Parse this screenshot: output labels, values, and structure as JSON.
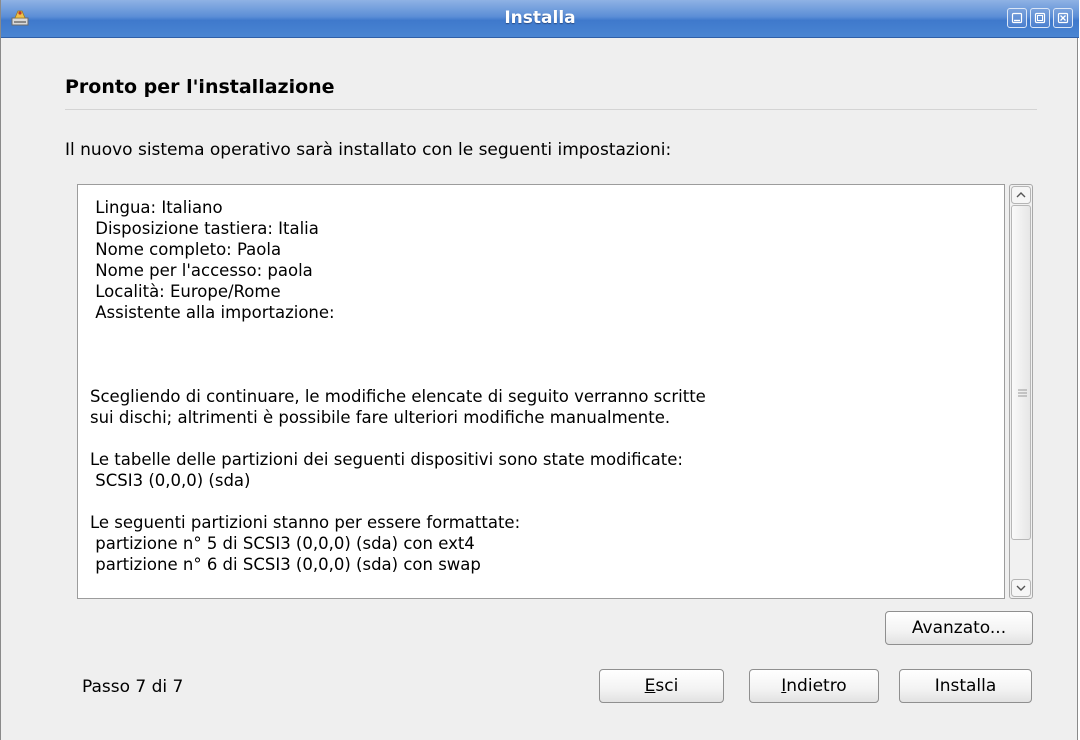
{
  "window": {
    "title": "Installa",
    "icon": "installer-icon",
    "controls": [
      "minimize-icon",
      "maximize-icon",
      "close-icon"
    ]
  },
  "page": {
    "heading": "Pronto per l'installazione",
    "intro": "Il nuovo sistema operativo sarà installato con le seguenti impostazioni:"
  },
  "summary": {
    "lines": [
      " Lingua: Italiano",
      " Disposizione tastiera: Italia",
      " Nome completo: Paola",
      " Nome per l'accesso: paola",
      " Località: Europe/Rome",
      " Assistente alla importazione:",
      "",
      "",
      "",
      "Scegliendo di continuare, le modifiche elencate di seguito verranno scritte",
      "sui dischi; altrimenti è possibile fare ulteriori modifiche manualmente.",
      "",
      "Le tabelle delle partizioni dei seguenti dispositivi sono state modificate:",
      " SCSI3 (0,0,0) (sda)",
      "",
      "Le seguenti partizioni stanno per essere formattate:",
      " partizione n° 5 di SCSI3 (0,0,0) (sda) con ext4",
      " partizione n° 6 di SCSI3 (0,0,0) (sda) con swap"
    ]
  },
  "buttons": {
    "advanced": "Avanzato...",
    "quit_mnemonic": "E",
    "quit_rest": "sci",
    "back_mnemonic": "I",
    "back_rest": "ndietro",
    "install": "Installa"
  },
  "status": {
    "step": "Passo 7 di 7"
  }
}
